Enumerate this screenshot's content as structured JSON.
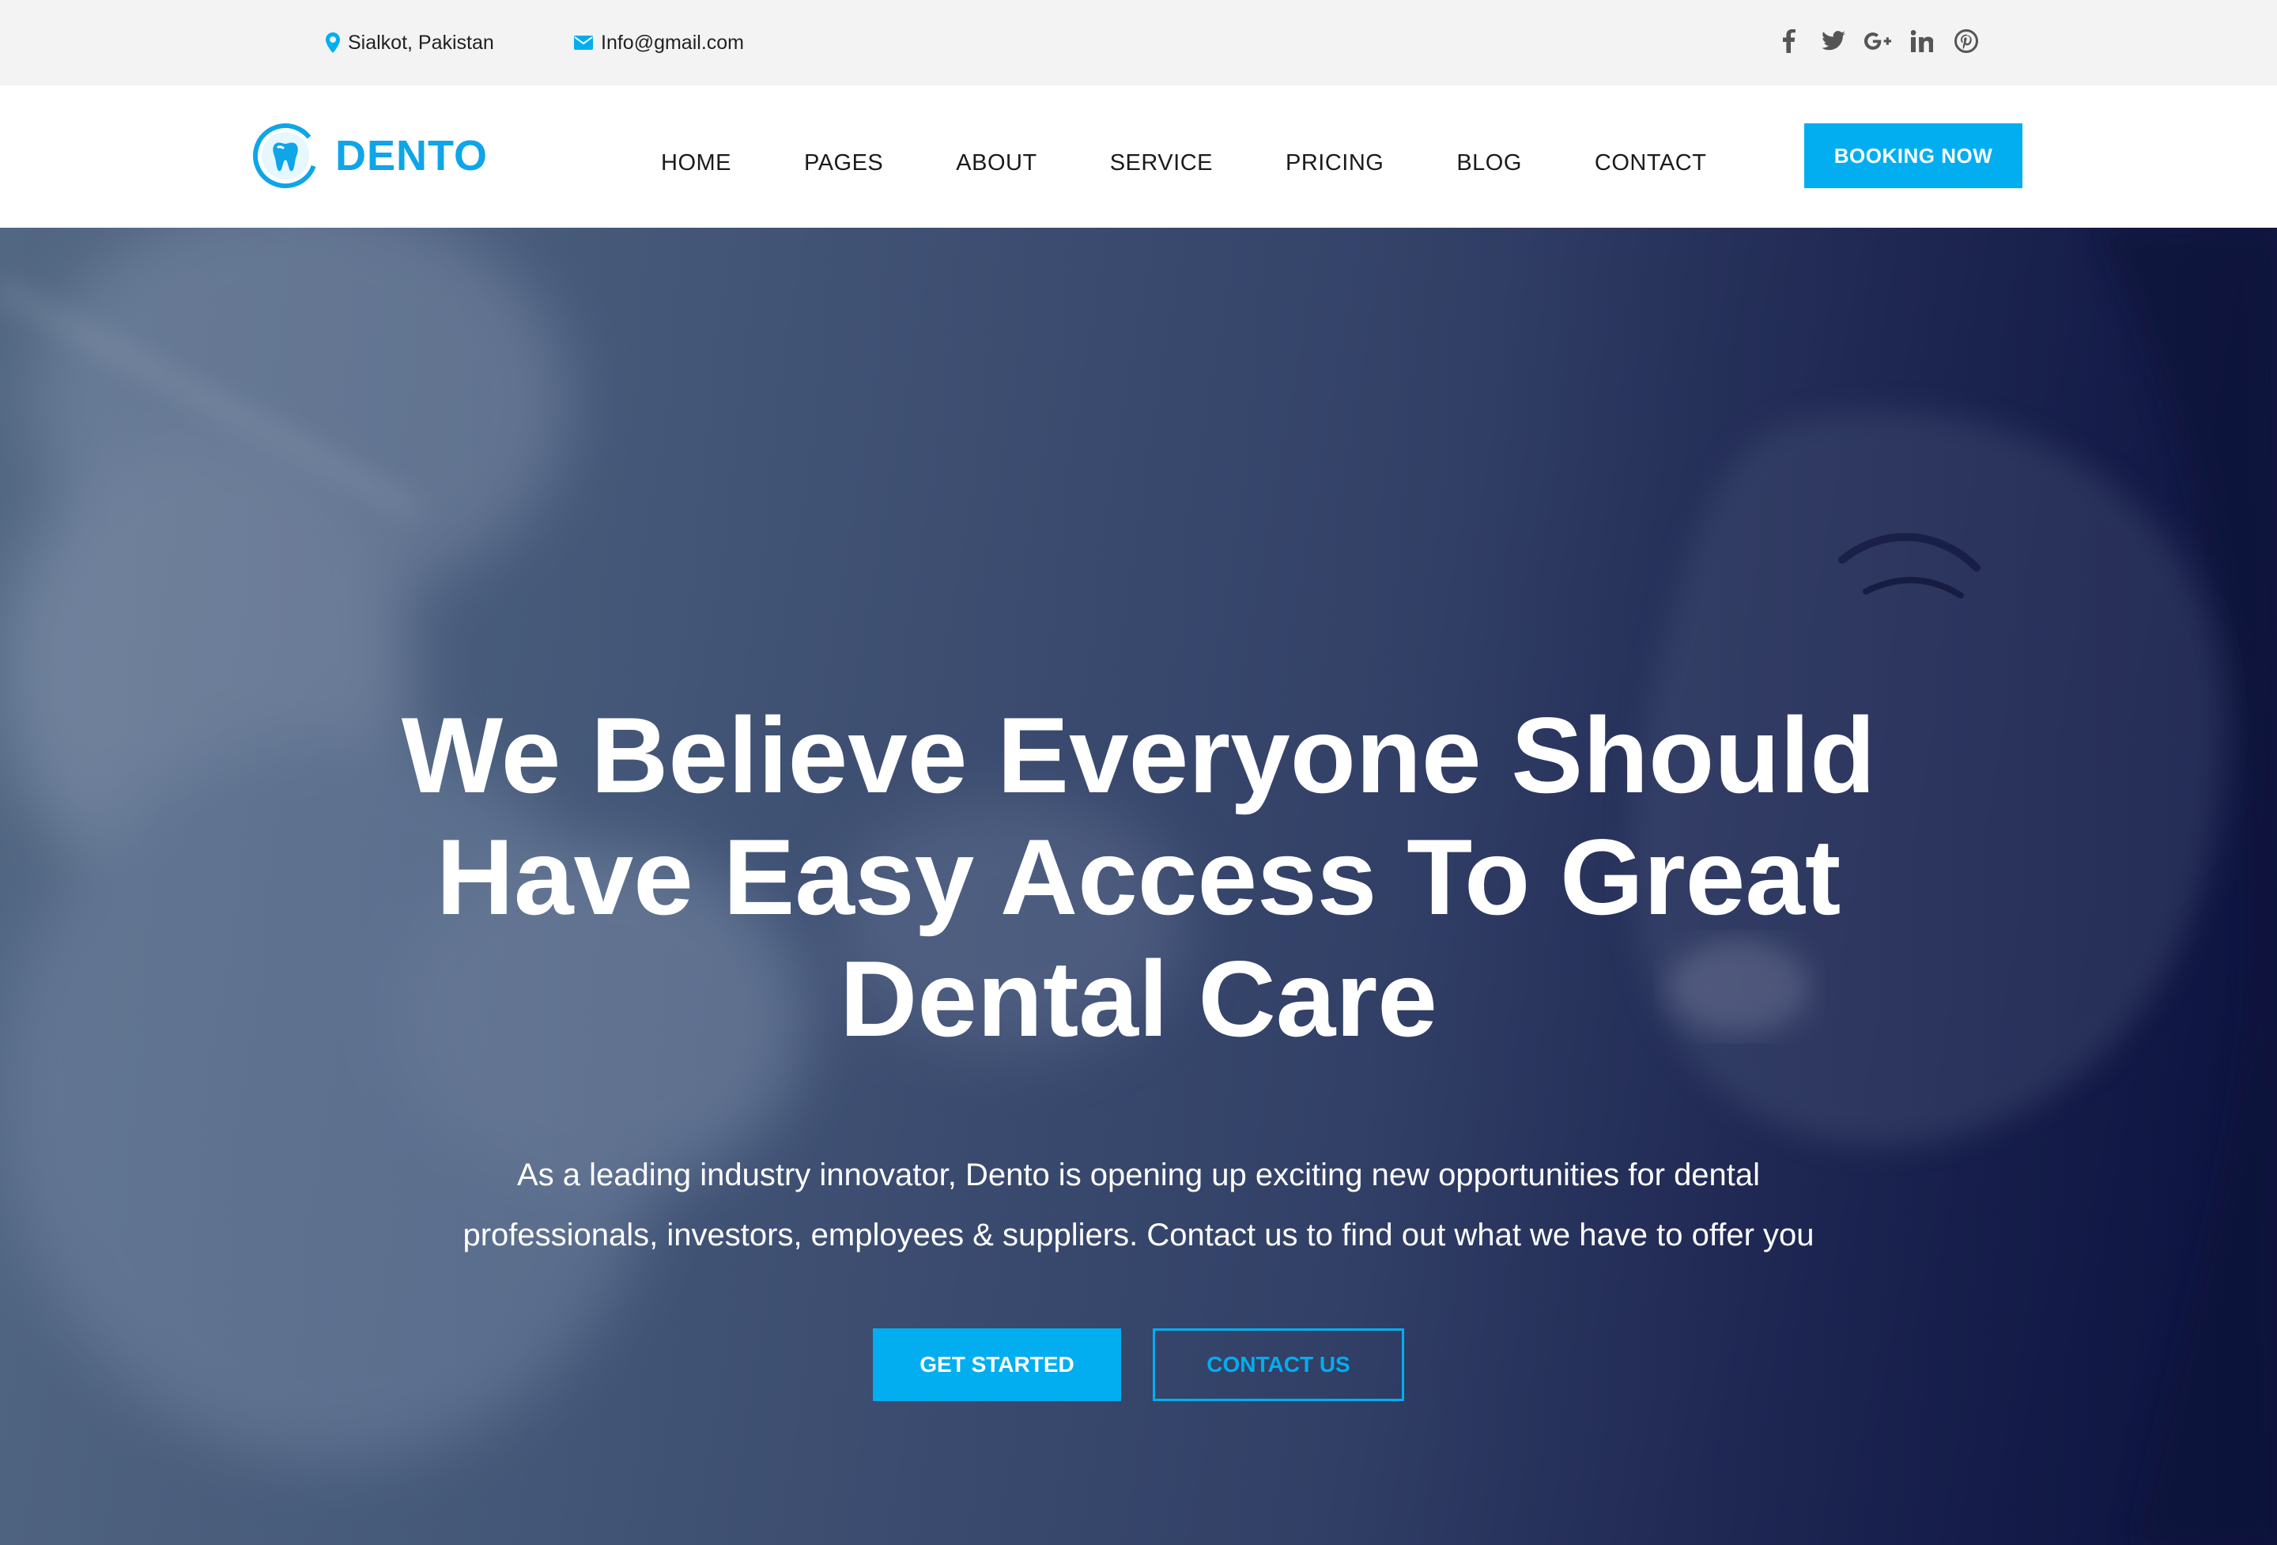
{
  "colors": {
    "accent": "#02aef0",
    "topbar_bg": "#f3f3f3",
    "hero_dark": "#1c2450"
  },
  "topbar": {
    "location": "Sialkot, Pakistan",
    "location_icon": "map-marker-icon",
    "email": "Info@gmail.com",
    "email_icon": "envelope-icon",
    "socials": [
      "facebook-icon",
      "twitter-icon",
      "google-plus-icon",
      "linkedin-icon",
      "pinterest-icon"
    ]
  },
  "header": {
    "logo_text": "DENTO",
    "logo_icon": "tooth-icon",
    "nav": [
      "HOME",
      "PAGES",
      "ABOUT",
      "SERVICE",
      "PRICING",
      "BLOG",
      "CONTACT"
    ],
    "booking_label": "BOOKING NOW"
  },
  "hero": {
    "title_line1": "We Believe Everyone Should",
    "title_line2": "Have Easy Access To Great",
    "title_line3": "Dental Care",
    "subtitle_line1": "As a leading industry innovator, Dento is opening up exciting new opportunities for dental",
    "subtitle_line2": "professionals, investors, employees & suppliers. Contact us to find out what we have to offer you",
    "primary_button": "GET STARTED",
    "secondary_button": "CONTACT US"
  }
}
